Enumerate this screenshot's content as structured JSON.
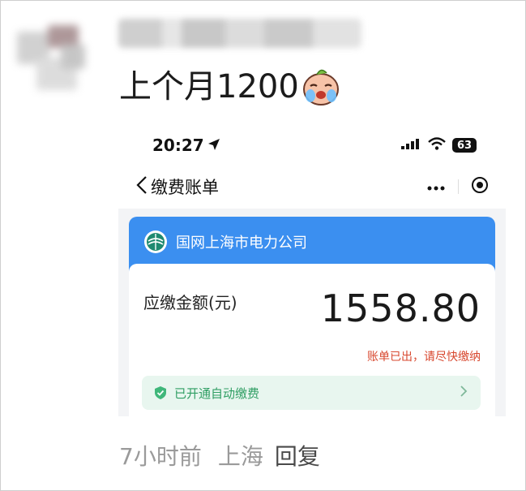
{
  "post": {
    "text": "上个月1200",
    "emoji_icon": "crying-face-icon"
  },
  "phone_screenshot": {
    "status_bar": {
      "time": "20:27",
      "location_icon": "location-arrow-icon",
      "signal_icon": "signal-icon",
      "wifi_icon": "wifi-icon",
      "battery_level": "63"
    },
    "navbar": {
      "back_icon": "chevron-left-icon",
      "title": "缴费账单",
      "more_icon": "more-dots-icon",
      "target_icon": "target-icon"
    },
    "company": {
      "name": "国网上海市电力公司",
      "logo_icon": "sgcc-logo-icon"
    },
    "bill": {
      "amount_label": "应缴金额(元)",
      "amount": "1558.80",
      "status_text": "账单已出，请尽快缴纳",
      "status_color": "#d8482f"
    },
    "autopay": {
      "text": "已开通自动缴费",
      "shield_icon": "shield-check-icon",
      "chevron_icon": "chevron-right-icon"
    }
  },
  "meta": {
    "time_ago": "7小时前",
    "location": "上海",
    "reply_label": "回复"
  },
  "colors": {
    "accent_blue": "#3b8ff0",
    "autopay_green": "#2f9e63"
  }
}
